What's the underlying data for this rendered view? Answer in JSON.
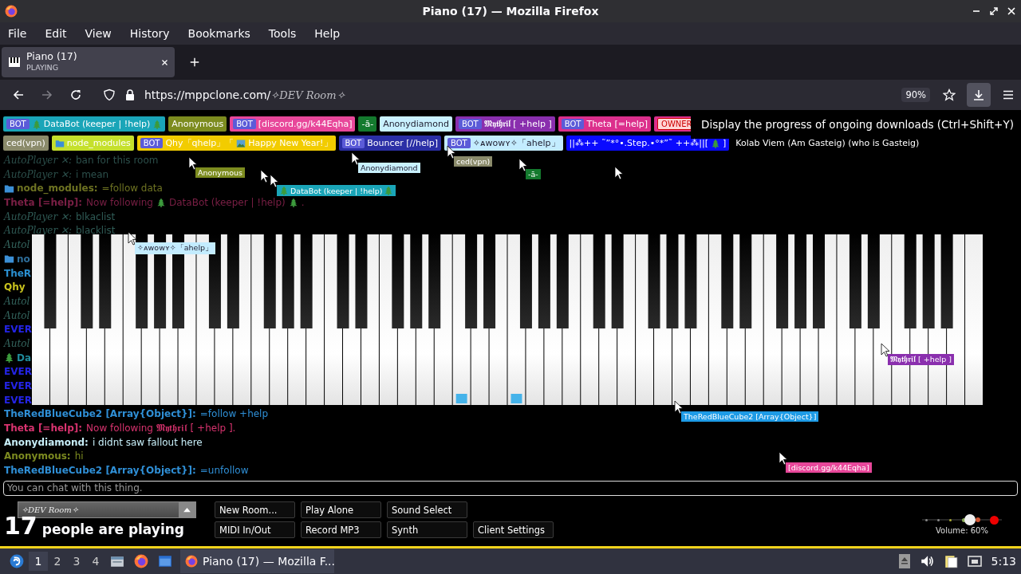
{
  "window": {
    "title": "Piano (17) — Mozilla Firefox"
  },
  "menu": [
    "File",
    "Edit",
    "View",
    "History",
    "Bookmarks",
    "Tools",
    "Help"
  ],
  "tabs": [
    {
      "title": "Piano (17)",
      "subtitle": "PLAYING",
      "selected": true
    }
  ],
  "address_bar": {
    "host": "https://mppclone.com/",
    "path": "✧DEV Room✧",
    "zoom": "90%"
  },
  "downloads_button": {
    "hovered": true
  },
  "tooltip": "Display the progress of ongoing downloads (Ctrl+Shift+Y)",
  "player_rows": [
    [
      {
        "badge": {
          "kind": "bot",
          "text": "BOT"
        },
        "parts": [
          {
            "kind": "tree"
          },
          {
            "kind": "text",
            "text": "DataBot (keeper | !help)"
          },
          {
            "kind": "tree"
          }
        ],
        "color": "#1aa5b8"
      },
      {
        "parts": [
          {
            "kind": "text",
            "text": "Anonymous"
          }
        ],
        "color": "#7d8c1f"
      },
      {
        "badge": {
          "kind": "bot",
          "text": "BOT"
        },
        "parts": [
          {
            "kind": "text",
            "text": "[discord.gg/k44Eqha]"
          }
        ],
        "color": "#e8479a"
      },
      {
        "parts": [
          {
            "kind": "text",
            "text": "-ā-"
          }
        ],
        "color": "#147a2e"
      },
      {
        "parts": [
          {
            "kind": "text",
            "text": "Anonydiamond"
          }
        ],
        "color": "#c9f1ff"
      },
      {
        "badge": {
          "kind": "bot",
          "text": "BOT"
        },
        "parts": [
          {
            "kind": "text",
            "text": "𝕸𝖞𝖙𝖍𝖗𝖎𝖑 [ +help ]"
          }
        ],
        "color": "#8a2fae"
      },
      {
        "badge": {
          "kind": "bot",
          "text": "BOT"
        },
        "parts": [
          {
            "kind": "text",
            "text": "Theta [=help]"
          }
        ],
        "color": "#dc2f8c"
      },
      {
        "badge": {
          "kind": "owner",
          "text": "OWNER"
        },
        "color": "#dc2f8c"
      }
    ],
    [
      {
        "parts": [
          {
            "kind": "text",
            "text": "ced(vpn)"
          }
        ],
        "color": "#8b8b6b"
      },
      {
        "parts": [
          {
            "kind": "folder"
          },
          {
            "kind": "text",
            "text": "node_modules"
          }
        ],
        "color": "#c5e02c"
      },
      {
        "badge": {
          "kind": "bot",
          "text": "BOT"
        },
        "parts": [
          {
            "kind": "text",
            "text": "Qhy「qhelp」「"
          },
          {
            "kind": "photo"
          },
          {
            "kind": "text",
            "text": "Happy New Year!」"
          }
        ],
        "color": "#f2cc00"
      },
      {
        "badge": {
          "kind": "bot",
          "text": "BOT"
        },
        "parts": [
          {
            "kind": "text",
            "text": "Bouncer [//help]"
          }
        ],
        "color": "#2b2fa6"
      },
      {
        "badge": {
          "kind": "bot",
          "text": "BOT"
        },
        "parts": [
          {
            "kind": "text",
            "text": "✧ᴀᴡᴏᴡʏ✧「ahelp」"
          }
        ],
        "color": "#c3ecff"
      },
      {
        "parts": [
          {
            "kind": "text",
            "text": "||⁂++ ˜”*°•.Step.•°*”˜ ++⁂||["
          },
          {
            "kind": "tree"
          },
          {
            "kind": "text",
            "text": "]"
          }
        ],
        "color": "#0a0aff"
      },
      {
        "parts": [
          {
            "kind": "text",
            "text": "Kolab Viem (Am Gasteig) (who is Gasteig)"
          }
        ]
      }
    ]
  ],
  "chat": [
    {
      "name": "AutoPlayer ✕:",
      "message": "ban for this room",
      "color": "#2c4f4b",
      "kind": "script"
    },
    {
      "name": "AutoPlayer ✕:",
      "message": "i mean",
      "color": "#2c4f4b",
      "kind": "script"
    },
    {
      "name": "node_modules:",
      "message": "=follow data",
      "color": "#6e7322",
      "kind": "folder"
    },
    {
      "name": "Theta [=help]:",
      "parts": [
        {
          "kind": "text",
          "text": "Now following"
        },
        {
          "kind": "tree"
        },
        {
          "kind": "text",
          "text": "DataBot (keeper | !help)"
        },
        {
          "kind": "tree"
        },
        {
          "kind": "text",
          "text": "."
        }
      ],
      "color": "#7a1f45",
      "kind": "plain"
    },
    {
      "name": "AutoPlayer ✕:",
      "message": "blkaclist",
      "color": "#2f5a55",
      "kind": "script"
    },
    {
      "name": "AutoPlayer ✕:",
      "message": "blacklist",
      "color": "#2f5a55",
      "kind": "script"
    },
    {
      "name": "Autol",
      "color": "#34655e",
      "kind": "script"
    },
    {
      "name": "no",
      "color": "#2e6e9a",
      "kind": "folder"
    },
    {
      "name": "TheR",
      "color": "#2a8fd0",
      "kind": "plain"
    },
    {
      "name": "Qhy",
      "color": "#c8c21e",
      "kind": "plain"
    },
    {
      "name": "Autol",
      "color": "#34655e",
      "kind": "script"
    },
    {
      "name": "Autol",
      "color": "#34655e",
      "kind": "script"
    },
    {
      "name": "EVER",
      "color": "#2424e6",
      "kind": "plain"
    },
    {
      "name": "Autol",
      "color": "#34655e",
      "kind": "script"
    },
    {
      "name": "Da",
      "color": "#1f8a9a",
      "kind": "tree"
    },
    {
      "name": "EVER",
      "color": "#2424e6",
      "kind": "plain"
    },
    {
      "name": "EVER",
      "color": "#2424e6",
      "kind": "plain"
    },
    {
      "name": "EVER",
      "color": "#2424e6",
      "kind": "plain"
    },
    {
      "name": "TheRedBlueCube2 [Array{Object}]:",
      "message": "=follow +help",
      "color": "#2f8fd6",
      "kind": "plain"
    },
    {
      "name": "Theta [=help]:",
      "message": "Now following 𝕸𝖞𝖙𝖍𝖗𝖎𝖑 [ +help ].",
      "color": "#d9336f",
      "kind": "plain"
    },
    {
      "name": "Anonydiamond:",
      "message": "i didnt saw fallout here",
      "color": "#c7eef8",
      "kind": "plain"
    },
    {
      "name": "Anonymous:",
      "message": "hi",
      "color": "#7c8a20",
      "kind": "plain"
    },
    {
      "name": "TheRedBlueCube2 [Array{Object}]:",
      "message": "=unfollow",
      "color": "#2f8fd6",
      "kind": "plain"
    }
  ],
  "cursors": [
    {
      "kind": "labeled",
      "parts": [
        {
          "kind": "text",
          "text": "Anonymous"
        }
      ],
      "color": "#7d8c1f"
    },
    {
      "kind": "labeled",
      "parts": [
        {
          "kind": "text",
          "text": "ced(vpn)"
        }
      ],
      "color": "#8b8b6b"
    },
    {
      "kind": "labeled",
      "parts": [
        {
          "kind": "text",
          "text": "Anonydiamond"
        }
      ],
      "color": "#c9f1ff"
    },
    {
      "kind": "labeled",
      "parts": [
        {
          "kind": "text",
          "text": "-ā-"
        }
      ],
      "color": "#147a2e"
    },
    {
      "kind": "pointer"
    },
    {
      "kind": "pointer"
    },
    {
      "kind": "labeled",
      "parts": [
        {
          "kind": "tree"
        },
        {
          "kind": "text",
          "text": "DataBot (keeper | !help)"
        },
        {
          "kind": "tree"
        }
      ],
      "color": "#1aa5b8"
    },
    {
      "kind": "labeled",
      "parts": [
        {
          "kind": "text",
          "text": "✧ᴀᴡᴏᴡʏ✧「ahelp」"
        }
      ],
      "color": "#c3ecff"
    },
    {
      "kind": "labeled",
      "parts": [
        {
          "kind": "text",
          "text": "𝕸𝖞𝖙𝖍𝖗𝖎𝖑 [ +help ]"
        }
      ],
      "color": "#8a2fae"
    },
    {
      "kind": "labeled",
      "parts": [
        {
          "kind": "text",
          "text": "TheRedBlueCube2 [Array{Object}]"
        }
      ],
      "color": "#1e9be6"
    },
    {
      "kind": "labeled",
      "parts": [
        {
          "kind": "text",
          "text": "[discord.gg/k44Eqha]"
        }
      ],
      "color": "#e8479a"
    }
  ],
  "piano": {
    "keys": [
      {
        "lit": false
      },
      {
        "lit": false
      },
      {
        "lit": false
      },
      {
        "lit": false
      },
      {
        "lit": false
      },
      {
        "lit": false
      },
      {
        "lit": false
      },
      {
        "lit": false
      },
      {
        "lit": false
      },
      {
        "lit": false
      },
      {
        "lit": false
      },
      {
        "lit": false
      },
      {
        "lit": false
      },
      {
        "lit": false
      },
      {
        "lit": false
      },
      {
        "lit": false
      },
      {
        "lit": false
      },
      {
        "lit": false
      },
      {
        "lit": false
      },
      {
        "lit": false
      },
      {
        "lit": false
      },
      {
        "lit": false
      },
      {
        "lit": false
      },
      {
        "lit": true
      },
      {
        "lit": false
      },
      {
        "lit": false
      },
      {
        "lit": true
      },
      {
        "lit": false
      },
      {
        "lit": false
      },
      {
        "lit": false
      },
      {
        "lit": false
      },
      {
        "lit": false
      },
      {
        "lit": false
      },
      {
        "lit": false
      },
      {
        "lit": false
      },
      {
        "lit": false
      },
      {
        "lit": false
      },
      {
        "lit": false
      },
      {
        "lit": false
      },
      {
        "lit": false
      },
      {
        "lit": false
      },
      {
        "lit": false
      },
      {
        "lit": false
      },
      {
        "lit": false
      },
      {
        "lit": false
      },
      {
        "lit": false
      },
      {
        "lit": false
      },
      {
        "lit": false
      },
      {
        "lit": false
      },
      {
        "lit": false
      },
      {
        "lit": false
      },
      {
        "lit": false
      }
    ]
  },
  "chat_input": {
    "placeholder": "You can chat with this thing."
  },
  "room_select": {
    "value": "✧DEV Room✧"
  },
  "player_count": {
    "number": "17",
    "label": "people are playing"
  },
  "button_rows": [
    [
      "New Room...",
      "Play Alone",
      "Sound Select"
    ],
    [
      "MIDI In/Out",
      "Record MP3",
      "Synth",
      "Client Settings"
    ]
  ],
  "volume": {
    "level": 0.6,
    "reading": "Volume: 60%"
  },
  "taskbar": {
    "workspaces": [
      {
        "label": "1",
        "selected": true
      },
      {
        "label": "2",
        "selected": false
      },
      {
        "label": "3",
        "selected": false
      },
      {
        "label": "4",
        "selected": false
      }
    ],
    "tasks": [
      {
        "title": "Piano (17) — Mozilla F...",
        "selected": true
      }
    ],
    "clock": "5:13"
  }
}
